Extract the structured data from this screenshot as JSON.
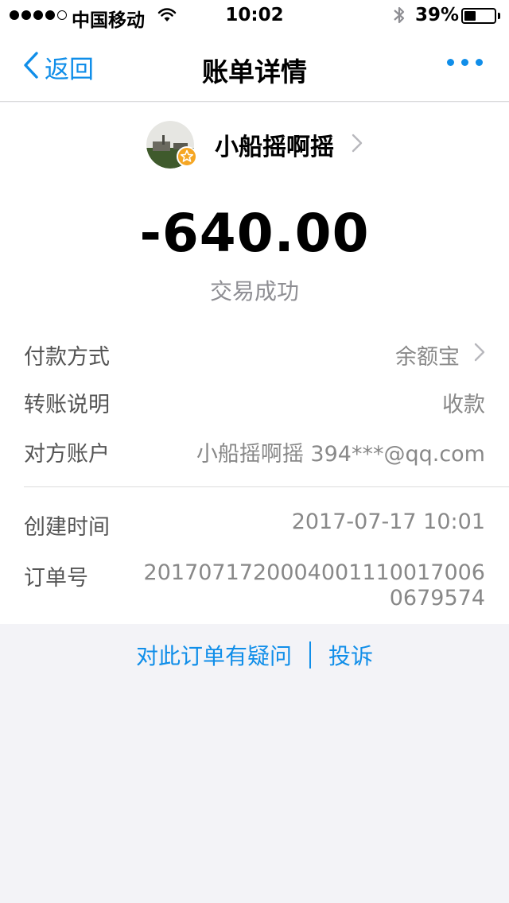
{
  "status_bar": {
    "carrier": "中国移动",
    "time": "10:02",
    "battery_percent": "39%",
    "battery_level": 0.39,
    "signal_bars_filled": 4,
    "icons": [
      "signal-dots",
      "wifi-icon",
      "bluetooth-icon",
      "battery-icon"
    ]
  },
  "nav": {
    "back_label": "返回",
    "title": "账单详情",
    "more_icon": "more-dots-icon",
    "accent_color": "#108ee9"
  },
  "payee": {
    "name": "小船摇啊摇"
  },
  "transaction": {
    "amount": "-640.00",
    "status": "交易成功"
  },
  "details": {
    "payment_method_label": "付款方式",
    "payment_method_value": "余额宝",
    "transfer_note_label": "转账说明",
    "transfer_note_value": "收款",
    "counterparty_label": "对方账户",
    "counterparty_value": "小船摇啊摇 394***@qq.com",
    "created_time_label": "创建时间",
    "created_time_value": "2017-07-17 10:01",
    "order_no_label": "订单号",
    "order_no_value": "20170717200040011100170060679574"
  },
  "footer": {
    "question_link": "对此订单有疑问",
    "complaint_link": "投诉"
  }
}
